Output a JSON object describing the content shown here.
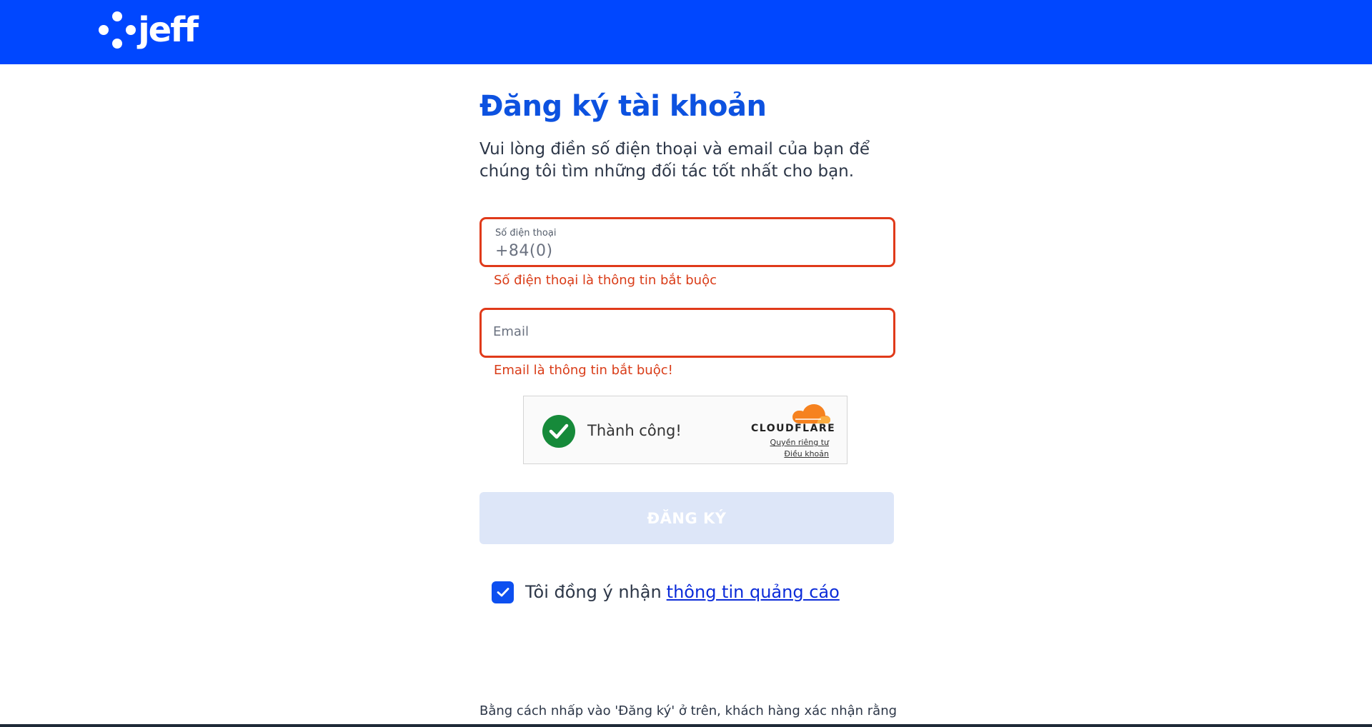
{
  "brand": {
    "name": "jeff",
    "primary_color": "#0047ff",
    "error_color": "#d93c18"
  },
  "form": {
    "title": "Đăng ký tài khoản",
    "subtitle": "Vui lòng điền số điện thoại và email của bạn để chúng tôi tìm những đối tác tốt nhất cho bạn.",
    "phone": {
      "label": "Số điện thoại",
      "value": "+84(0)",
      "error": "Số điện thoại là thông tin bắt buộc"
    },
    "email": {
      "placeholder": "Email",
      "error": "Email là thông tin bắt buộc!"
    },
    "captcha": {
      "status": "Thành công!",
      "provider": "CLOUDFLARE",
      "privacy_link": "Quyền riêng tư",
      "terms_link": "Điều khoản",
      "icon": "check-circle-icon"
    },
    "submit_label": "ĐĂNG KÝ",
    "consent": {
      "checked": true,
      "text": "Tôi đồng ý nhận",
      "link": "thông tin quảng cáo"
    },
    "footer_note": "Bằng cách nhấp vào 'Đăng ký' ở trên, khách hàng xác nhận rằng"
  }
}
